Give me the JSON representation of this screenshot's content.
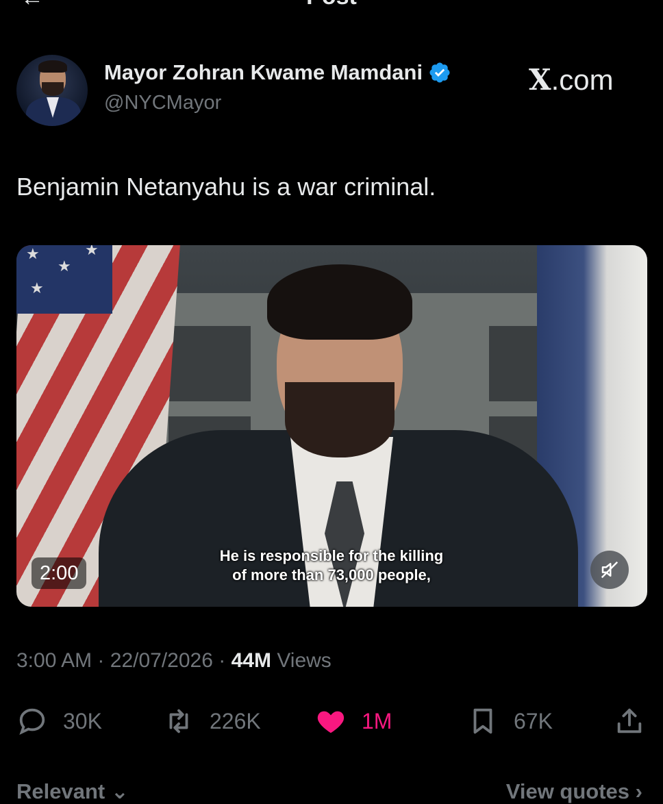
{
  "header": {
    "back_icon": "arrow-left-icon",
    "title": "Post"
  },
  "author": {
    "display_name": "Mayor Zohran Kwame Mamdani",
    "handle": "@NYCMayor",
    "verified_color": "#1d9bf0",
    "verified_icon": "verified-badge-icon"
  },
  "brand": {
    "letter": "X",
    "suffix": ".com"
  },
  "post": {
    "text": "Benjamin Netanyahu is a war criminal.",
    "video": {
      "duration": "2:00",
      "caption_line1": "He is responsible for the killing",
      "caption_line2": "of more than 73,000 people,",
      "mute_icon": "speaker-muted-icon"
    },
    "time": "3:00 AM",
    "date": "22/07/2026",
    "views_count": "44M",
    "views_label": "Views",
    "separator": "·"
  },
  "actions": {
    "replies": "30K",
    "reposts": "226K",
    "likes": "1M",
    "like_color": "#f91880",
    "bookmarks": "67K"
  },
  "footer": {
    "sort_label": "Relevant",
    "view_quotes": "View quotes"
  },
  "colors": {
    "background": "#000000",
    "text": "#e7e9ea",
    "muted": "#71767b"
  }
}
